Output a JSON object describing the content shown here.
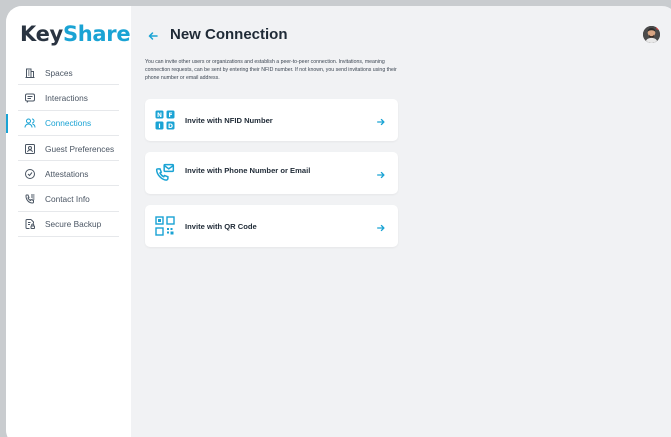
{
  "brand": {
    "part1": "Key",
    "part2": "Share"
  },
  "sidebar": {
    "items": [
      {
        "label": "Spaces",
        "icon": "building-icon",
        "active": false
      },
      {
        "label": "Interactions",
        "icon": "message-icon",
        "active": false
      },
      {
        "label": "Connections",
        "icon": "users-icon",
        "active": true
      },
      {
        "label": "Guest Preferences",
        "icon": "badge-icon",
        "active": false
      },
      {
        "label": "Attestations",
        "icon": "check-badge-icon",
        "active": false
      },
      {
        "label": "Contact Info",
        "icon": "phone-list-icon",
        "active": false
      },
      {
        "label": "Secure Backup",
        "icon": "file-lock-icon",
        "active": false
      }
    ]
  },
  "page": {
    "title": "New Connection",
    "description": "You can invite other users or organizations and establish a peer-to-peer connection. Invitations, meaning connection requests, can be sent by entering their NFID number. If not known, you send invitations using their phone number or email address."
  },
  "options": [
    {
      "label": "Invite with NFID Number",
      "icon": "nfid-icon"
    },
    {
      "label": "Invite with Phone Number or Email",
      "icon": "phone-mail-icon"
    },
    {
      "label": "Invite with QR Code",
      "icon": "qr-code-icon"
    }
  ],
  "colors": {
    "accent": "#1aa3d4",
    "text": "#1f2a36",
    "background": "#f1f2f4"
  }
}
